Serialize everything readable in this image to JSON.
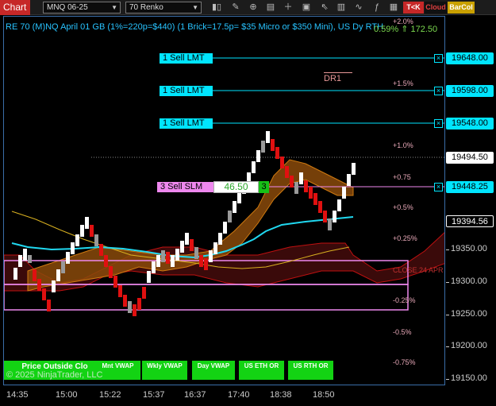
{
  "toolbar": {
    "chart_tab": "Chart",
    "instrument": "MNQ 06-25",
    "bar_type": "70 Renko",
    "icons": [
      "bar-style-icon",
      "pencil-icon",
      "zoom-icon",
      "properties-icon",
      "crosshair-icon",
      "order-icon",
      "arrow-icon",
      "chart-trader-icon",
      "strategy-icon",
      "tk-icon"
    ],
    "tk_label": "T<K",
    "cloud_label": "Cloud",
    "barcol_label": "BarCol"
  },
  "chart": {
    "title": "RE 70 (M)NQ April 01 GB (1%=220p=$440) (1 Brick=17.5p= $35 Micro or $350 Mini), US Dy RTH",
    "indicator": "0.59% ⇑ 172.50",
    "dr1_label": "DR1",
    "close_label": "CLOSE 24 APR",
    "pct_labels": [
      "+2.0%",
      "+1.5%",
      "+1.0%",
      "+0.75",
      "+0.5%",
      "+0.25%",
      "-0.25%",
      "-0.5%",
      "-0.75%"
    ],
    "orders": [
      {
        "label": "1 Sell LMT",
        "price": "19648.00"
      },
      {
        "label": "1 Sell LMT",
        "price": "19598.00"
      },
      {
        "label": "1 Sell LMT",
        "price": "19548.00"
      }
    ],
    "slm_order": {
      "label": "3 Sell SLM",
      "price_value": "46.50",
      "qty": "3",
      "price": "19448.25"
    },
    "current_price": "19494.50",
    "ema_price": "19394.56",
    "position_button": "Price Outside Clo",
    "copyright": "© 2025 NinjaTrader, LLC",
    "vwap_buttons": [
      "Mnt VWAP",
      "Wkly VWAP",
      "Day VWAP",
      "US ETH OR",
      "US RTH OR"
    ]
  },
  "price_axis": {
    "ticks": [
      "19350.00",
      "19300.00",
      "19250.00",
      "19200.00",
      "19150.00"
    ]
  },
  "time_axis": {
    "ticks": [
      "14:35",
      "15:00",
      "15:22",
      "15:37",
      "16:37",
      "17:40",
      "18:38",
      "18:50"
    ]
  },
  "colors": {
    "accent": "#00e5ff",
    "up_brick": "#ffffff",
    "down_brick": "#e01010",
    "cloud": "#b5650f"
  }
}
